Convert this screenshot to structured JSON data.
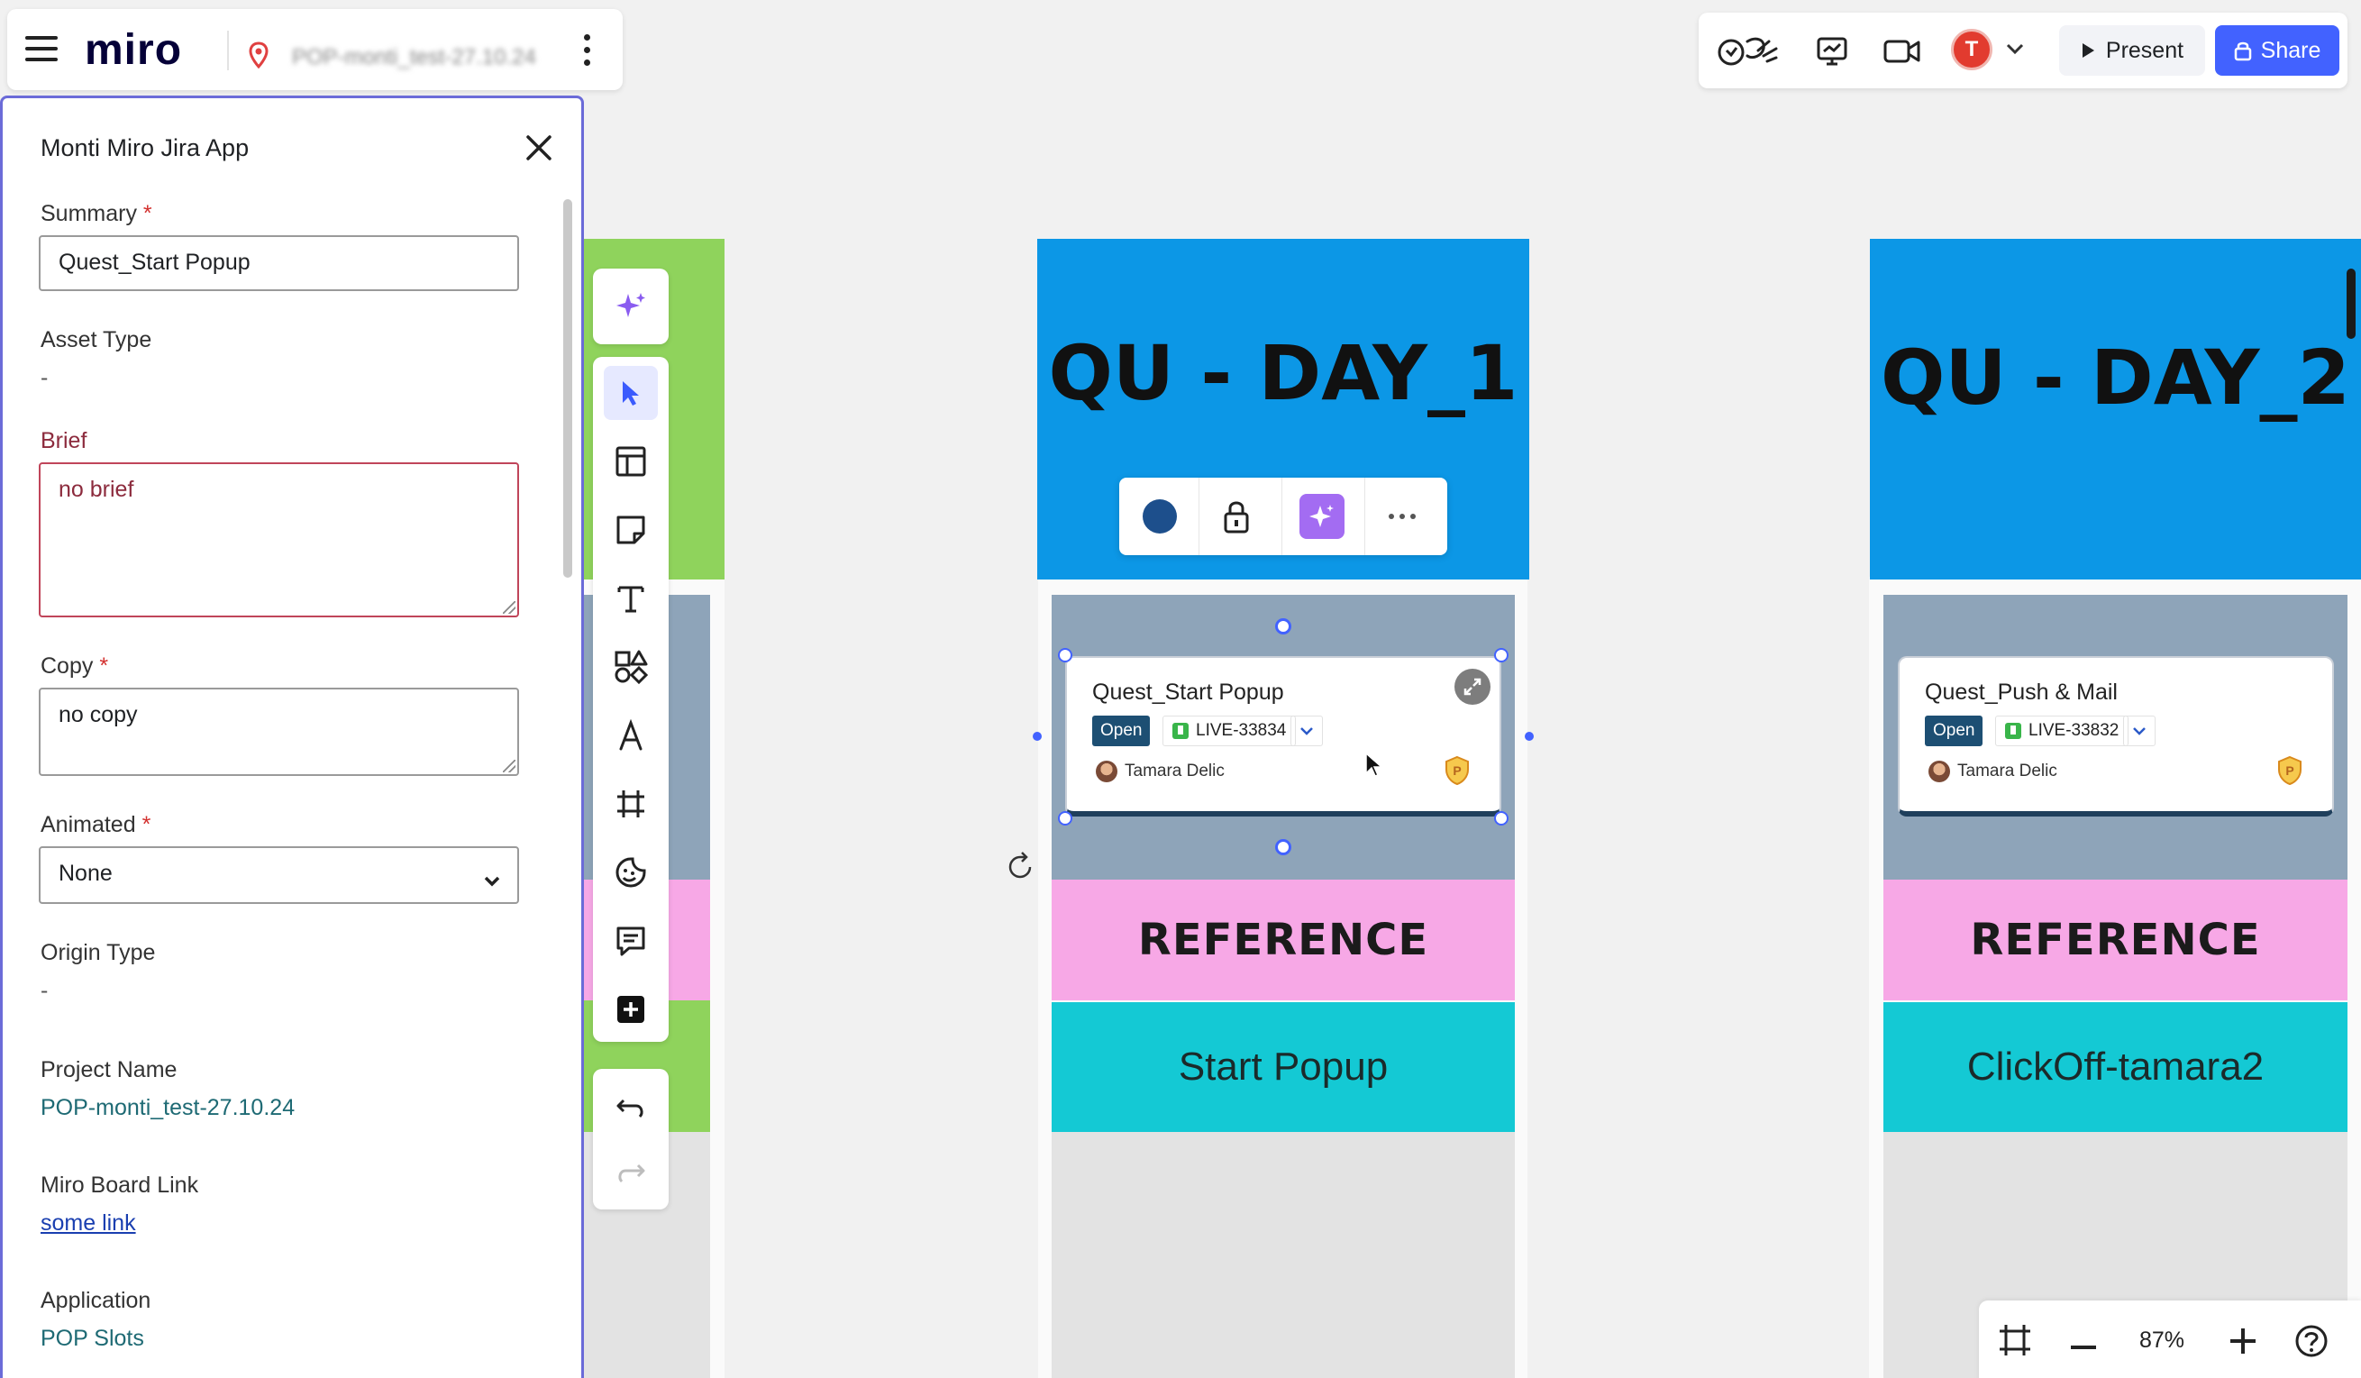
{
  "app": {
    "logo": "miro",
    "board_name": "POP-monti_test-27.10.24"
  },
  "topbar_right": {
    "avatar_initial": "T",
    "present_label": "Present",
    "share_label": "Share"
  },
  "panel": {
    "title": "Monti Miro Jira App",
    "summary_label": "Summary",
    "summary_value": "Quest_Start Popup",
    "asset_type_label": "Asset Type",
    "asset_type_value": "-",
    "brief_label": "Brief",
    "brief_value": "no brief",
    "copy_label": "Copy",
    "copy_value": "no copy",
    "animated_label": "Animated",
    "animated_value": "None",
    "origin_type_label": "Origin Type",
    "origin_type_value": "-",
    "project_name_label": "Project Name",
    "project_name_value": "POP-monti_test-27.10.24",
    "board_link_label": "Miro Board Link",
    "board_link_value": "some link",
    "application_label": "Application",
    "application_value": "POP Slots",
    "required_mark": "*"
  },
  "board": {
    "columns": [
      {
        "header": "QU - DAY_1",
        "card": {
          "title": "Quest_Start Popup",
          "status": "Open",
          "key": "LIVE-33834",
          "assignee": "Tamara Delic"
        },
        "reference": "REFERENCE",
        "name": "Start Popup"
      },
      {
        "header": "QU - DAY_2",
        "card": {
          "title": "Quest_Push & Mail",
          "status": "Open",
          "key": "LIVE-33832",
          "assignee": "Tamara Delic"
        },
        "reference": "REFERENCE",
        "name": "ClickOff-tamara2"
      }
    ]
  },
  "zoom": {
    "level": "87%"
  },
  "colors": {
    "header_blue": "#0c97e6",
    "reference_pink": "#f7a8e6",
    "name_cyan": "#14c9d4",
    "status_open": "#1d4f73",
    "accent": "#4262ff",
    "side_green": "#8fd35c"
  },
  "icons": [
    "hamburger-icon",
    "location-pin-icon",
    "more-vertical-icon",
    "reactions-icon",
    "presentation-icon",
    "video-icon",
    "chevron-down-icon",
    "play-icon",
    "lock-icon",
    "close-icon",
    "sparkle-icon",
    "cursor-icon",
    "table-icon",
    "sticky-note-icon",
    "text-icon",
    "shapes-icon",
    "pen-icon",
    "frame-icon",
    "sticker-icon",
    "comment-icon",
    "plus-square-icon",
    "undo-icon",
    "redo-icon",
    "expand-icon",
    "shield-icon",
    "rotate-icon",
    "minus-icon",
    "plus-icon",
    "help-icon",
    "fit-frame-icon"
  ]
}
